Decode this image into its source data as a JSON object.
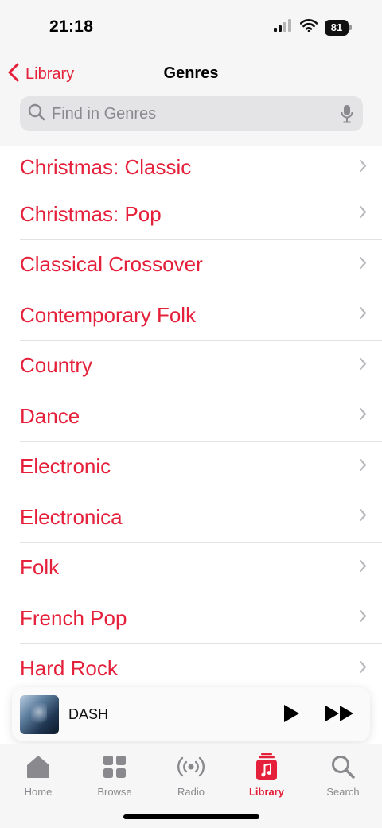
{
  "status_bar": {
    "time": "21:18",
    "battery": "81",
    "icons": [
      "signal-icon",
      "wifi-icon",
      "battery-icon"
    ]
  },
  "nav": {
    "back_label": "Library",
    "title": "Genres"
  },
  "search": {
    "placeholder": "Find in Genres",
    "value": ""
  },
  "genres": [
    "Christmas: Classic",
    "Christmas: Pop",
    "Classical Crossover",
    "Contemporary Folk",
    "Country",
    "Dance",
    "Electronic",
    "Electronica",
    "Folk",
    "French Pop",
    "Hard Rock"
  ],
  "now_playing": {
    "title": "DASH"
  },
  "tabs": [
    {
      "label": "Home",
      "icon": "home-icon",
      "active": false
    },
    {
      "label": "Browse",
      "icon": "browse-grid-icon",
      "active": false
    },
    {
      "label": "Radio",
      "icon": "radio-icon",
      "active": false
    },
    {
      "label": "Library",
      "icon": "library-icon",
      "active": true
    },
    {
      "label": "Search",
      "icon": "search-icon",
      "active": false
    }
  ],
  "colors": {
    "accent": "#e5203a",
    "tab_inactive": "#8a8a8e",
    "bar_background": "#f6f6f6"
  }
}
